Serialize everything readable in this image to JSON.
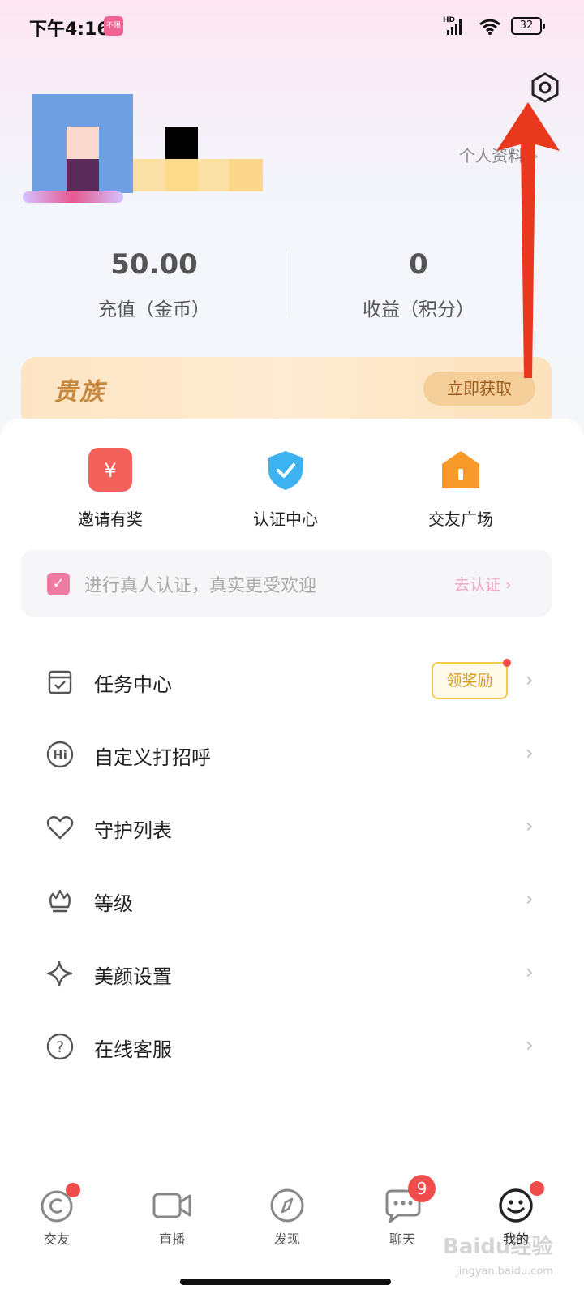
{
  "status_bar": {
    "time": "下午4:16",
    "badge": "不限",
    "network": "HD",
    "battery": "32"
  },
  "profile": {
    "link_label": "个人资料",
    "link_chevron": "›"
  },
  "stats": [
    {
      "value": "50.00",
      "label": "充值（金币）"
    },
    {
      "value": "0",
      "label": "收益（积分）"
    }
  ],
  "noble": {
    "title": "贵族",
    "button": "立即获取"
  },
  "quick_actions": [
    {
      "label": "邀请有奖",
      "icon": "yuan-icon",
      "color": "#f4605a",
      "glyph": "¥"
    },
    {
      "label": "认证中心",
      "icon": "shield-check-icon",
      "color": "#3cb3f0",
      "glyph": "✓"
    },
    {
      "label": "交友广场",
      "icon": "house-icon",
      "color": "#f89a2a",
      "glyph": "▮"
    }
  ],
  "verify": {
    "check": "✓",
    "text": "进行真人认证，真实更受欢迎",
    "link": "去认证 ›"
  },
  "menu": [
    {
      "label": "任务中心",
      "icon": "task-calendar-icon",
      "badge": "领奖励"
    },
    {
      "label": "自定义打招呼",
      "icon": "hi-icon"
    },
    {
      "label": "守护列表",
      "icon": "heart-icon"
    },
    {
      "label": "等级",
      "icon": "crown-icon"
    },
    {
      "label": "美颜设置",
      "icon": "sparkle-icon"
    },
    {
      "label": "在线客服",
      "icon": "question-icon"
    }
  ],
  "menu_chevron": "›",
  "bottom_nav": [
    {
      "label": "交友",
      "icon": "friends-icon",
      "dot": true
    },
    {
      "label": "直播",
      "icon": "video-icon"
    },
    {
      "label": "发现",
      "icon": "compass-icon"
    },
    {
      "label": "聊天",
      "icon": "chat-icon",
      "count": "9"
    },
    {
      "label": "我的",
      "icon": "smile-icon",
      "dot": true
    }
  ],
  "watermark": {
    "title": "Baidu经验",
    "sub": "jingyan.baidu.com"
  },
  "colors": {
    "accent_pink": "#f07ba2",
    "gold": "#c7873d",
    "red_dot": "#f04c4c",
    "annotation_arrow": "#e8391f"
  }
}
